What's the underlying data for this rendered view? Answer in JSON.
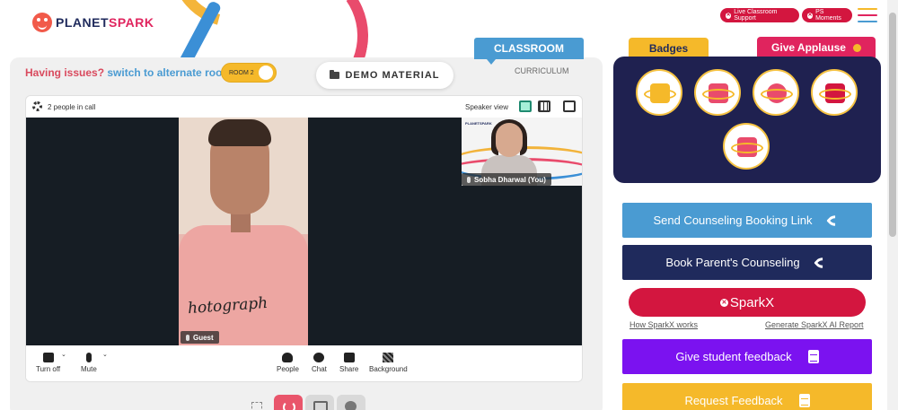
{
  "header": {
    "logo_planet": "PLANET",
    "logo_spark": "SPARK",
    "support_label": "Live Classroom Support",
    "moments_label": "PS Moments"
  },
  "colors": {
    "brand_red": "#d3163f",
    "brand_navy": "#1f2a5c",
    "brand_blue": "#4a9bd2",
    "brand_yellow": "#f5b92a",
    "feedback_purple": "#7b12f0"
  },
  "tabs": {
    "classroom": "CLASSROOM",
    "curriculum": "CURRICULUM",
    "badges": "Badges",
    "give_applause": "Give Applause"
  },
  "main": {
    "issue_text": "Having issues?",
    "issue_link": "switch to alternate room",
    "room_label": "ROOM 2",
    "demo_material": "DEMO MATERIAL"
  },
  "video": {
    "people_count": "2 people in call",
    "view_label": "Speaker view",
    "guest_name": "Guest",
    "teacher_name": "Sobha Dharwal (You)",
    "teacher_logo": "PLANETSPARK",
    "shirt_text": "hotograph",
    "controls": {
      "camera": "Turn off",
      "mic": "Mute",
      "people": "People",
      "chat": "Chat",
      "share": "Share",
      "background": "Background"
    }
  },
  "icons": {
    "settings": "gear-icon",
    "speaker_view": "speaker-view-icon",
    "grid_view": "grid-view-icon",
    "pip": "picture-in-picture-icon",
    "camera": "camera-icon",
    "mic": "mic-icon",
    "people": "people-icon",
    "chat": "chat-icon",
    "share": "share-icon",
    "background": "background-icon",
    "phone": "phone-icon",
    "document": "document-icon"
  },
  "actions": {
    "counseling_link": "Send Counseling Booking Link",
    "parent_counseling": "Book Parent's Counseling",
    "sparkx": "SparkX",
    "how_sparkx": "How SparkX works",
    "generate_report": "Generate SparkX AI Report",
    "student_feedback": "Give student feedback",
    "request_feedback": "Request Feedback"
  }
}
